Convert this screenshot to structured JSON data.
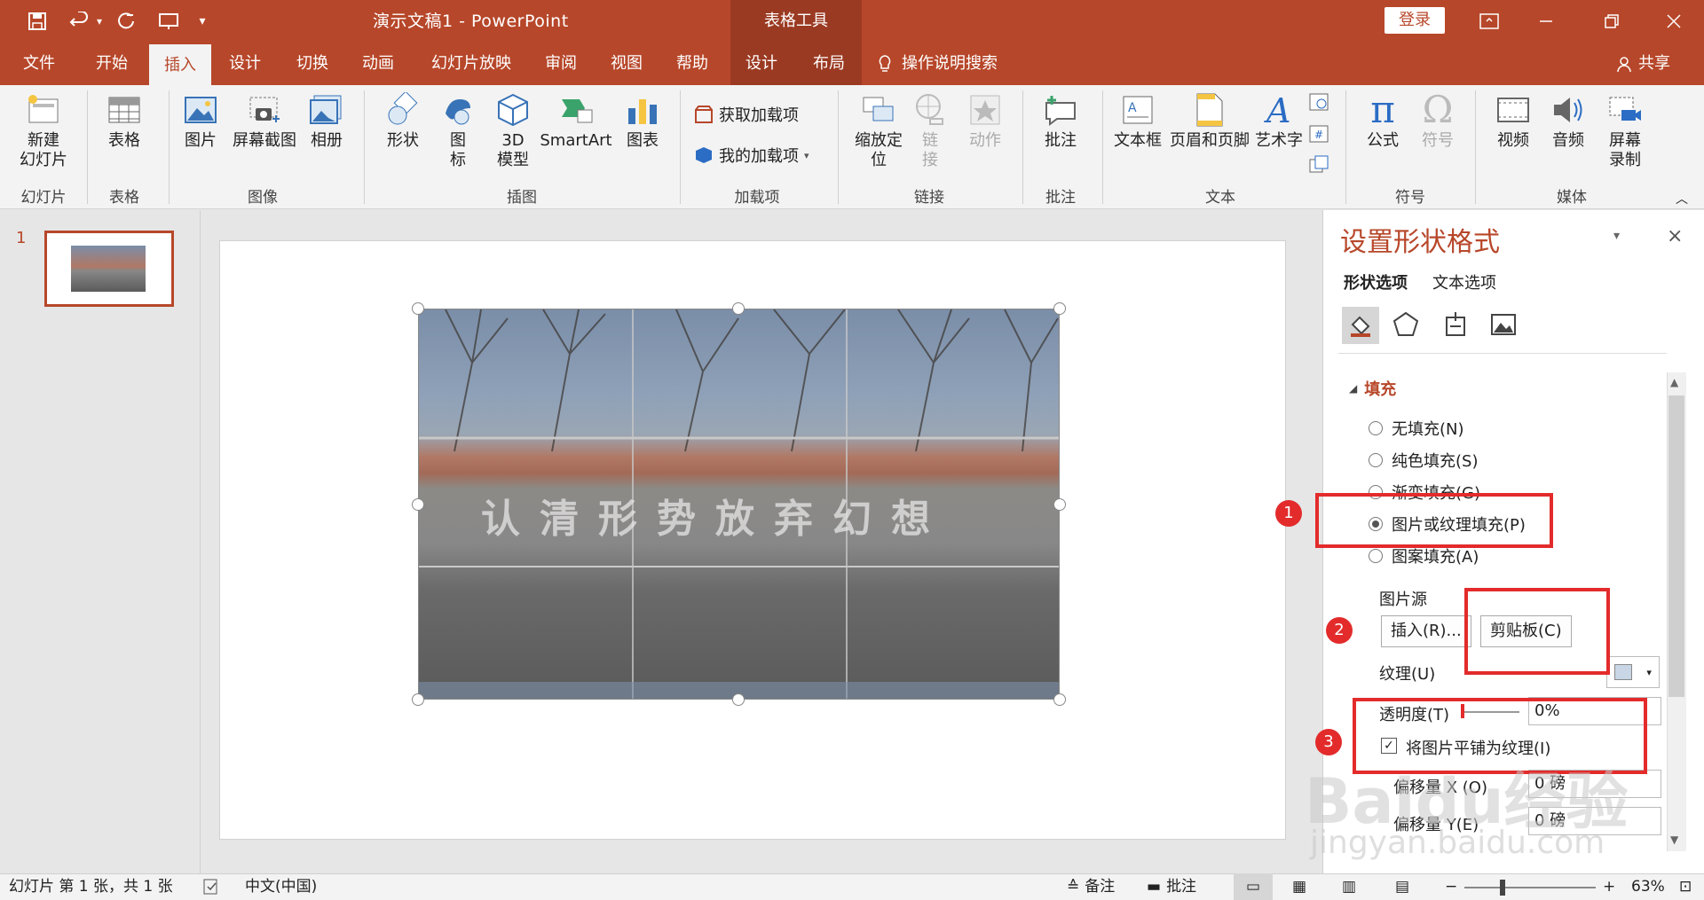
{
  "window": {
    "doc_title": "演示文稿1  -  PowerPoint",
    "context_tools": "表格工具",
    "login": "登录",
    "share": "共享"
  },
  "tabs": [
    "文件",
    "开始",
    "插入",
    "设计",
    "切换",
    "动画",
    "幻灯片放映",
    "审阅",
    "视图",
    "帮助",
    "设计",
    "布局"
  ],
  "tell_me": "操作说明搜索",
  "ribbon": {
    "new_slide": "新建\n幻灯片",
    "table": "表格",
    "picture": "图片",
    "screenshot": "屏幕截图",
    "album": "相册",
    "shapes": "形状",
    "icons": "图\n标",
    "model3d": "3D\n模型",
    "smartart": "SmartArt",
    "chart": "图表",
    "get_addins": "获取加载项",
    "my_addins": "我的加载项",
    "zoom": "缩放定\n位",
    "link": "链\n接",
    "action": "动作",
    "comment": "批注",
    "textbox": "文本框",
    "header_footer": "页眉和页脚",
    "wordart": "艺术字",
    "equation": "公式",
    "symbol": "符号",
    "video": "视频",
    "audio": "音频",
    "screen_record": "屏幕\n录制",
    "groups": {
      "slides": "幻灯片",
      "tables": "表格",
      "images": "图像",
      "illustrations": "插图",
      "addins": "加载项",
      "links": "链接",
      "comments": "批注",
      "text": "文本",
      "symbols": "符号",
      "media": "媒体"
    }
  },
  "thumb": {
    "number": "1"
  },
  "slide": {
    "picture_text": "认清形势放弃幻想"
  },
  "panel": {
    "title": "设置形状格式",
    "tab_shape": "形状选项",
    "tab_text": "文本选项",
    "fill_header": "填充",
    "options": [
      "无填充(N)",
      "纯色填充(S)",
      "渐变填充(G)",
      "图片或纹理填充(P)",
      "图案填充(A)"
    ],
    "picture_source": "图片源",
    "insert_btn": "插入(R)...",
    "clipboard_btn": "剪贴板(C)",
    "texture": "纹理(U)",
    "transparency": "透明度(T)",
    "transparency_value": "0%",
    "tile_checkbox": "将图片平铺为纹理(I)",
    "offset_x": "偏移量 X (O)",
    "offset_x_value": "0 磅",
    "offset_y": "偏移量 Y(E)",
    "offset_y_value": "0 磅"
  },
  "annotations": [
    "1",
    "2",
    "3"
  ],
  "status": {
    "slide_info": "幻灯片 第 1 张，共 1 张",
    "language": "中文(中国)",
    "notes": "备注",
    "comments": "批注",
    "zoom": "63%"
  },
  "watermark": {
    "main": "Baidu经验",
    "sub": "jingyan.baidu.com"
  },
  "colors": {
    "accent": "#b7472a",
    "annotation": "#e32b2b"
  }
}
